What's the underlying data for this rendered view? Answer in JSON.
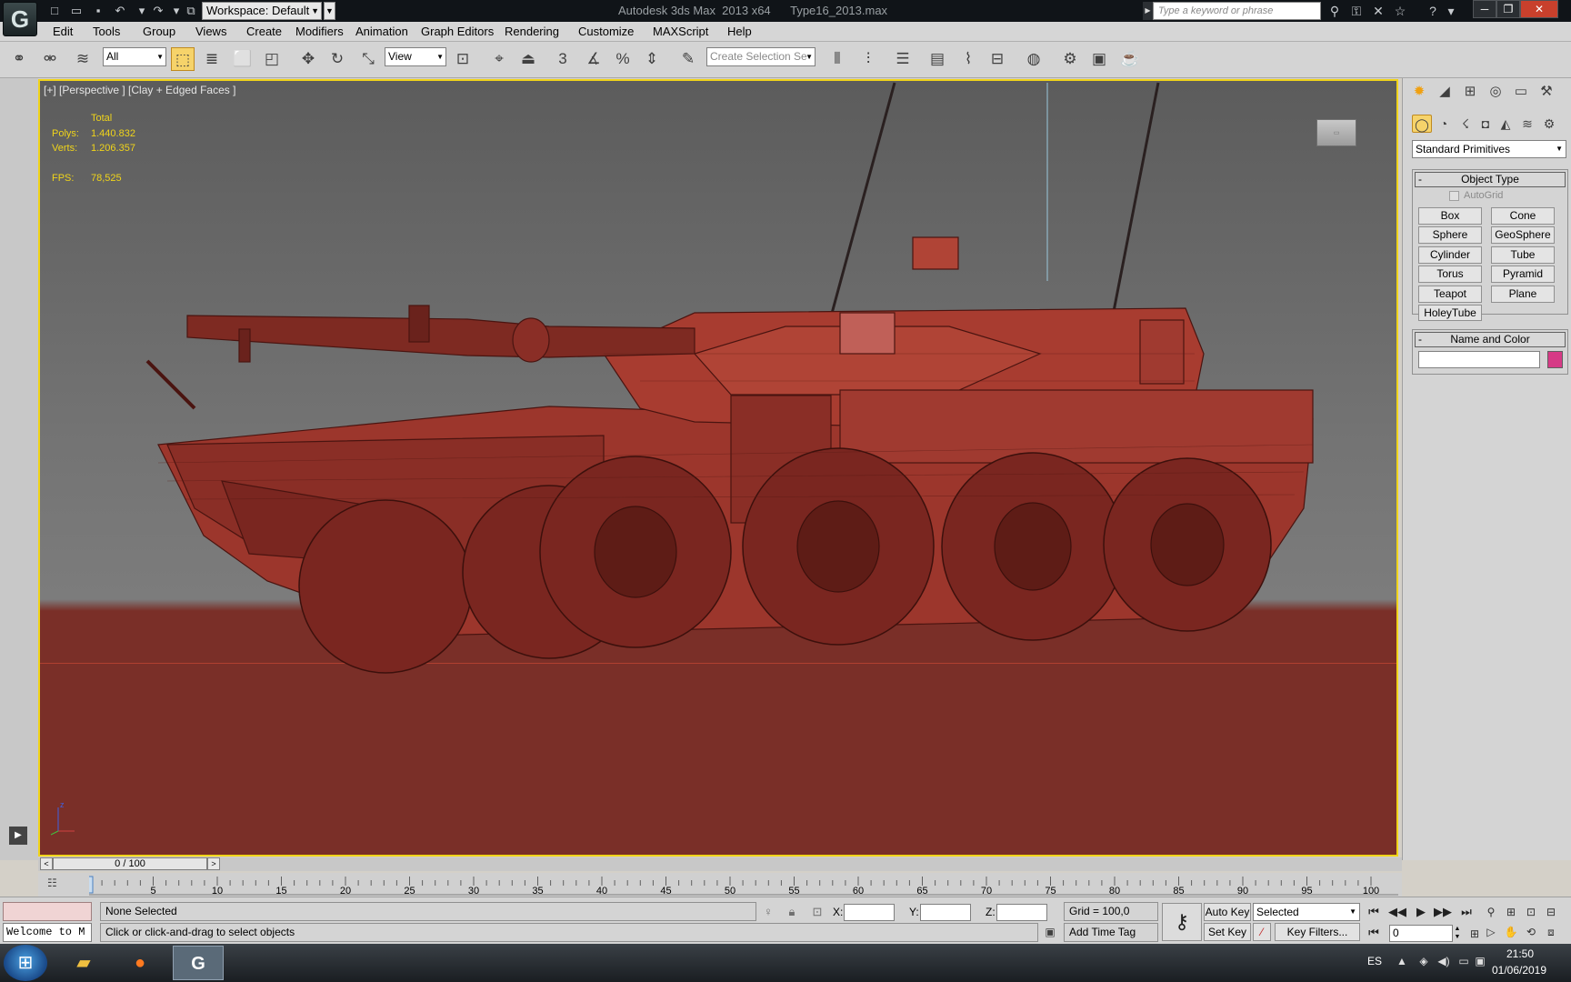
{
  "titlebar": {
    "workspace": "Workspace: Default",
    "title": "Autodesk 3ds Max  2013 x64      Type16_2013.max",
    "search_placeholder": "Type a keyword or phrase"
  },
  "menu": [
    "Edit",
    "Tools",
    "Group",
    "Views",
    "Create",
    "Modifiers",
    "Animation",
    "Graph Editors",
    "Rendering",
    "Customize",
    "MAXScript",
    "Help"
  ],
  "toolbar": {
    "selection_filter": "All",
    "ref_coord": "View",
    "named_selection_placeholder": "Create Selection Se",
    "snap_label": "3"
  },
  "viewport": {
    "label": "[+] [Perspective ] [Clay + Edged Faces ]",
    "stats_header": "Total",
    "polys_label": "Polys:",
    "polys": "1.440.832",
    "verts_label": "Verts:",
    "verts": "1.206.357",
    "fps_label": "FPS:",
    "fps": "78,525",
    "axis_z": "z"
  },
  "command_panel": {
    "category": "Standard Primitives",
    "object_type_title": "Object Type",
    "autogrid": "AutoGrid",
    "objects": [
      "Box",
      "Cone",
      "Sphere",
      "GeoSphere",
      "Cylinder",
      "Tube",
      "Torus",
      "Pyramid",
      "Teapot",
      "Plane",
      "HoleyTube"
    ],
    "name_color_title": "Name and Color",
    "swatch_color": "#d63a86"
  },
  "timeline": {
    "frame_readout": "0 / 100",
    "ticks": [
      "5",
      "10",
      "15",
      "20",
      "25",
      "30",
      "35",
      "40",
      "45",
      "50",
      "55",
      "60",
      "65",
      "70",
      "75",
      "80",
      "85",
      "90",
      "95",
      "100"
    ]
  },
  "status": {
    "maxscript_text": "Welcome to M",
    "selection": "None Selected",
    "prompt": "Click or click-and-drag to select objects",
    "x_label": "X:",
    "y_label": "Y:",
    "z_label": "Z:",
    "grid": "Grid = 100,0",
    "add_time_tag": "Add Time Tag",
    "auto_key": "Auto Key",
    "set_key": "Set Key",
    "selected": "Selected",
    "key_filters": "Key Filters...",
    "frame": "0"
  },
  "taskbar": {
    "lang": "ES",
    "time": "21:50",
    "date": "01/06/2019"
  },
  "colors": {
    "viewport_border": "#f0d41a",
    "stats_text": "#f0d41a",
    "clay": "#a0392f"
  }
}
